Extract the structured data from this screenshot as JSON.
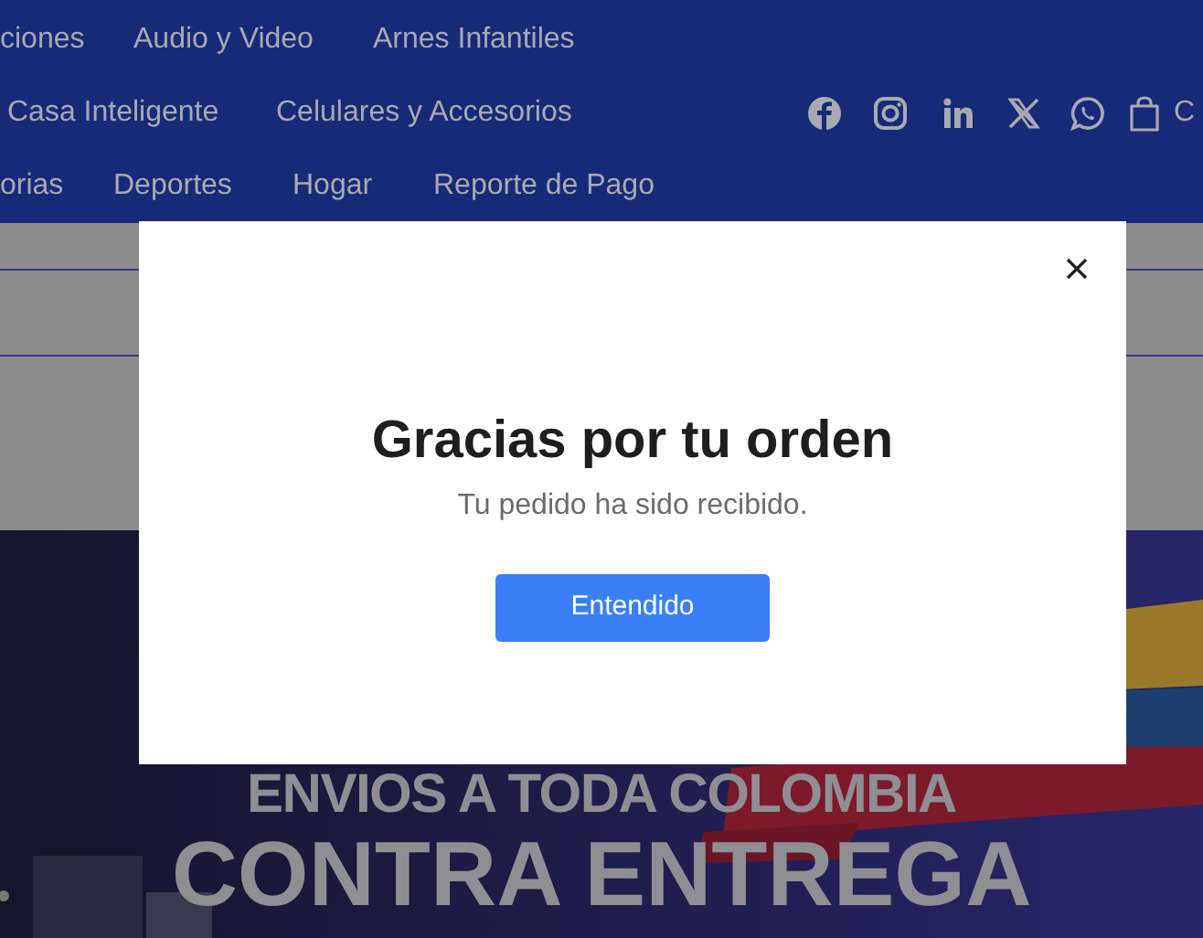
{
  "nav": {
    "links": [
      {
        "label": "ciones"
      },
      {
        "label": "Audio y Video"
      },
      {
        "label": "Arnes Infantiles"
      },
      {
        "label": "Casa Inteligente"
      },
      {
        "label": "Celulares y Accesorios"
      },
      {
        "label": "orias"
      },
      {
        "label": "Deportes"
      },
      {
        "label": "Hogar"
      },
      {
        "label": "Reporte de Pago"
      }
    ],
    "cart_label": "C"
  },
  "banner": {
    "lines": [
      "ENVIOS A TODA COLOMBIA",
      "CONTRA ENTREGA"
    ]
  },
  "modal": {
    "title": "Gracias por tu orden",
    "message": "Tu pedido ha sido recibido.",
    "button": "Entendido"
  }
}
